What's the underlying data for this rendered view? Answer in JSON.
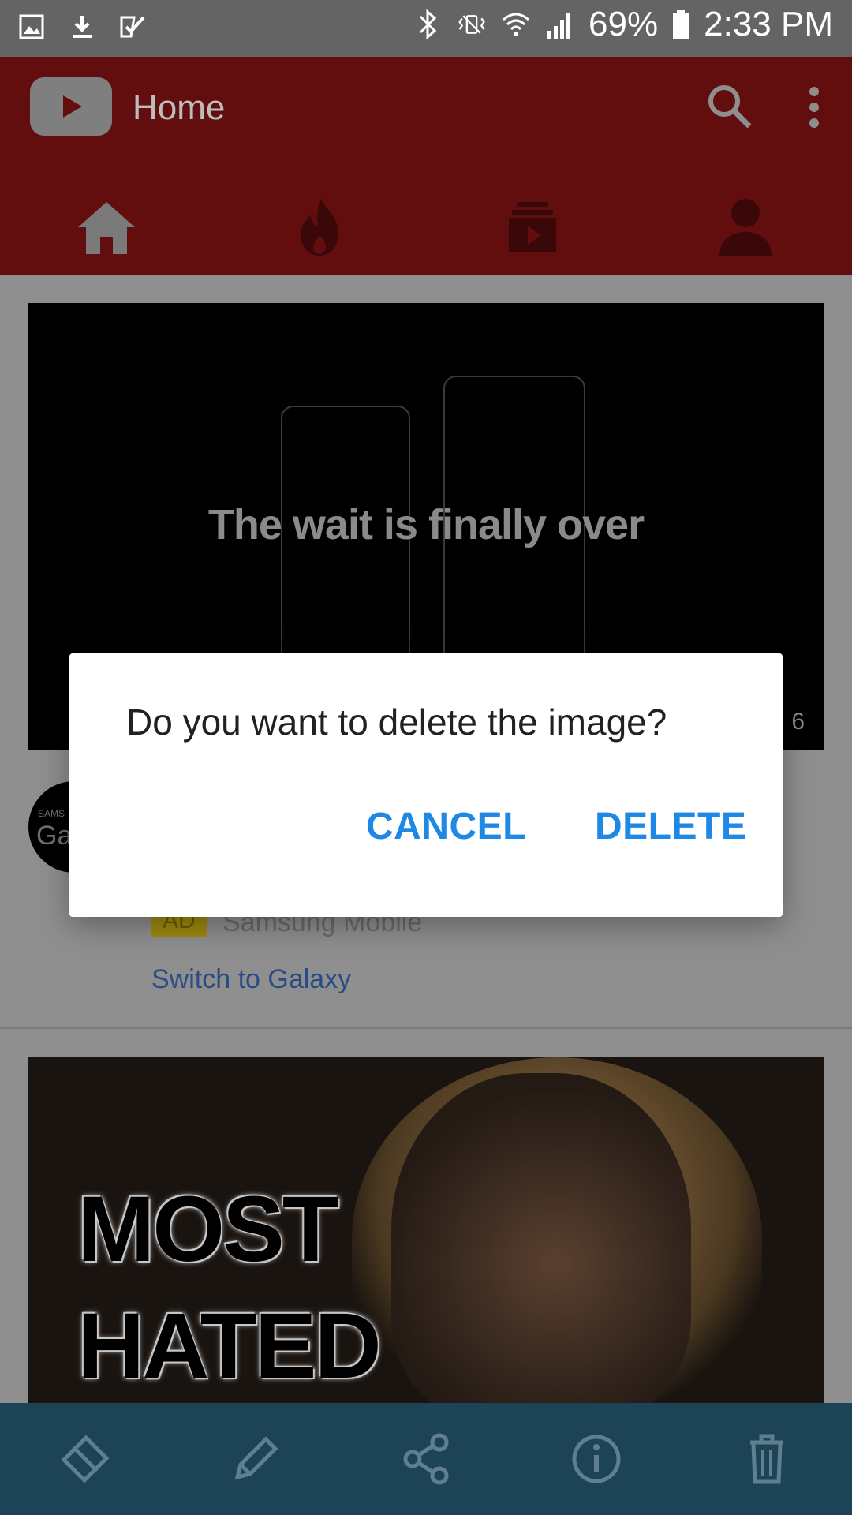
{
  "status_bar": {
    "battery": "69%",
    "time": "2:33 PM"
  },
  "header": {
    "title": "Home"
  },
  "feed": {
    "ad_video_overlay_text": "The wait is finally over",
    "ad_duration_partial": "6",
    "ad_badge": "AD",
    "ad_channel": "Samsung Mobile",
    "ad_cta": "Switch to Galaxy",
    "avatar_text": "Ga",
    "avatar_small_text": "SAMS",
    "thumb2_text_line1": "MOST",
    "thumb2_text_line2": "HATED"
  },
  "dialog": {
    "message": "Do you want to delete the image?",
    "cancel_label": "CANCEL",
    "delete_label": "DELETE"
  },
  "colors": {
    "status_bar_bg": "#646464",
    "appbar_bg": "#630e0e",
    "dialog_button": "#1e88e5",
    "bottom_bar_bg": "#1d4456"
  },
  "icons": {
    "bottom_bar": [
      "crop-rotate-icon",
      "edit-pencil-icon",
      "share-icon",
      "info-icon",
      "trash-icon"
    ],
    "tabs": [
      "home-icon",
      "trending-flame-icon",
      "subscriptions-icon",
      "account-icon"
    ]
  }
}
